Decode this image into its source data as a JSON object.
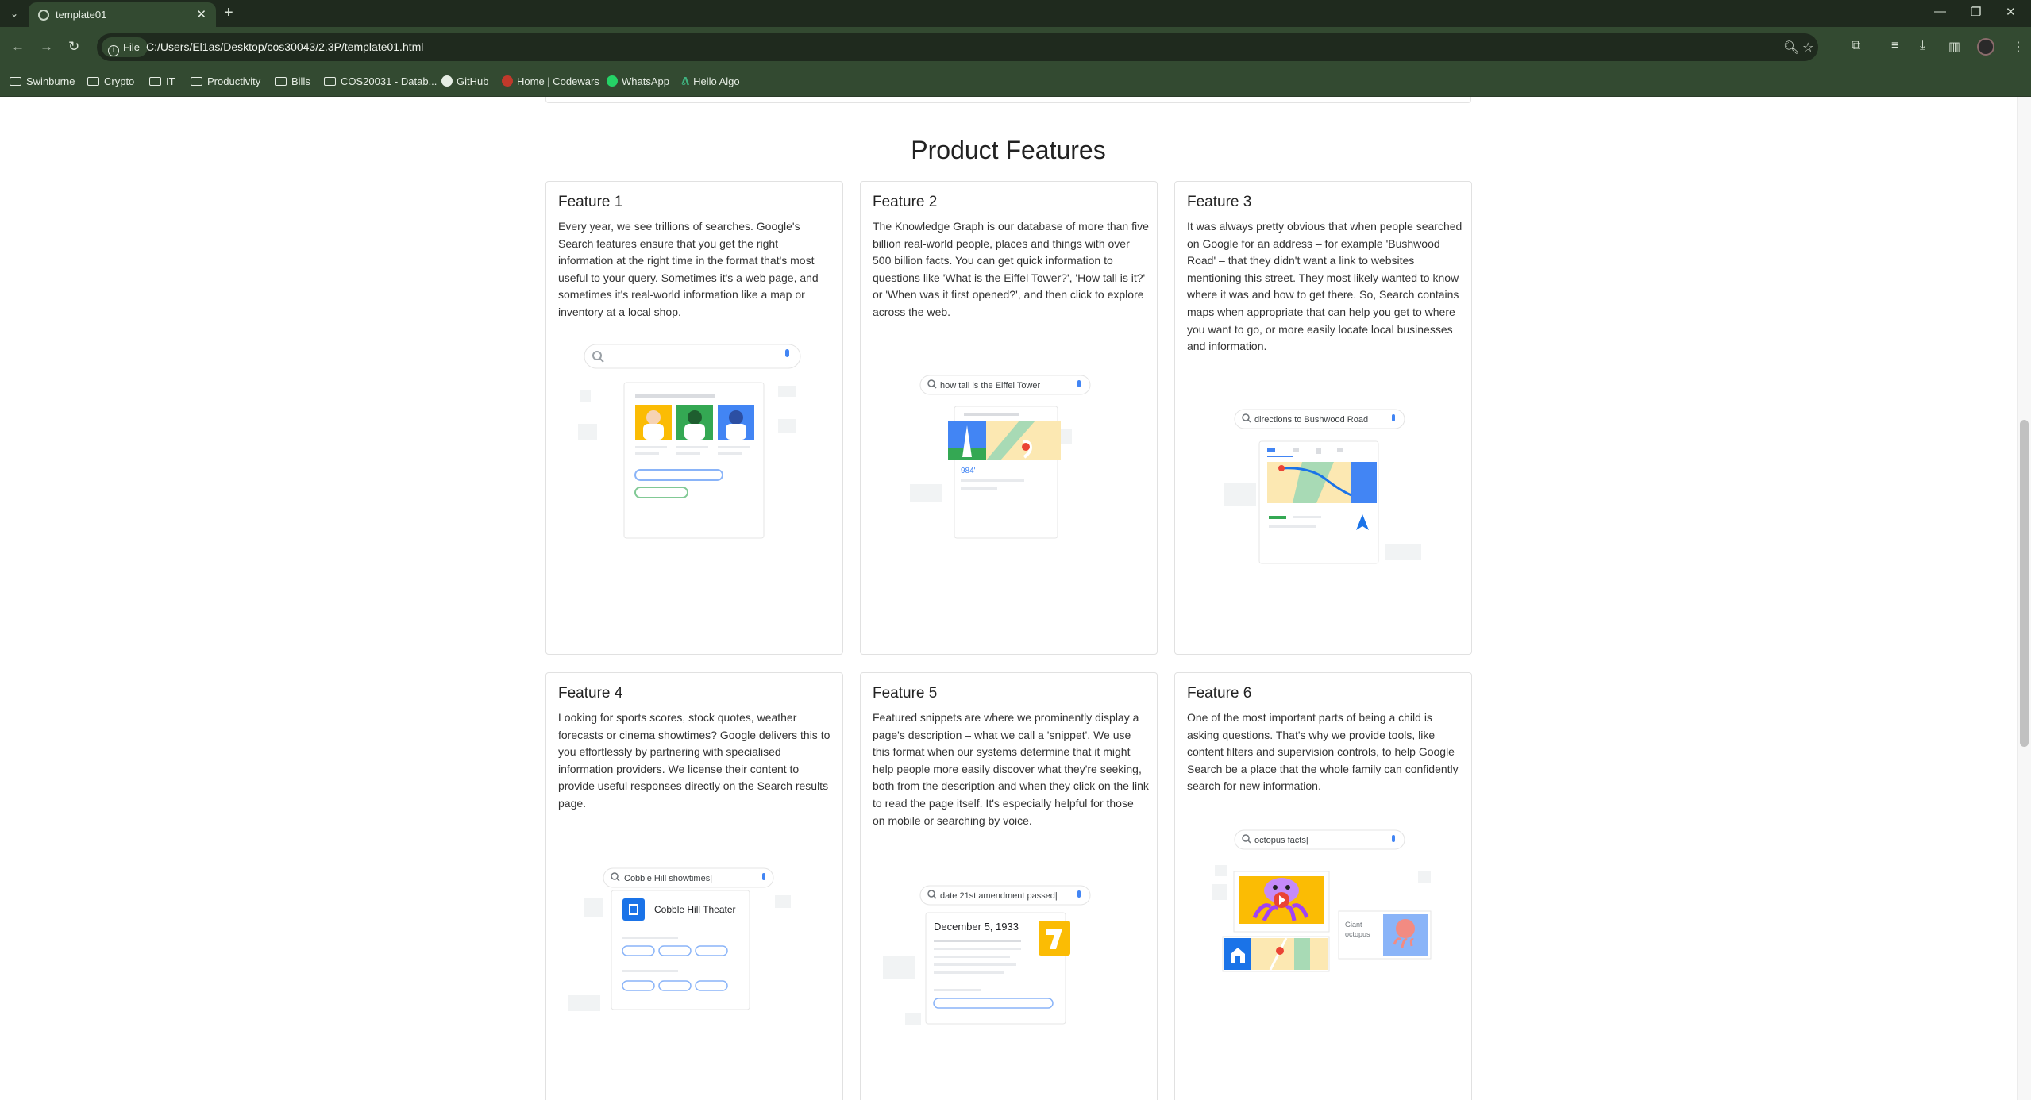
{
  "browser": {
    "tab_title": "template01",
    "url_scheme": "File",
    "url": "C:/Users/El1as/Desktop/cos30043/2.3P/template01.html",
    "bookmarks": [
      "Swinburne",
      "Crypto",
      "IT",
      "Productivity",
      "Bills",
      "COS20031 - Datab...",
      "GitHub",
      "Home | Codewars",
      "WhatsApp",
      "Hello Algo"
    ]
  },
  "page": {
    "section_title": "Product Features",
    "features": [
      {
        "title": "Feature 1",
        "text": "Every year, we see trillions of searches. Google's Search features ensure that you get the right information at the right time in the format that's most useful to your query. Sometimes it's a web page, and sometimes it's real-world information like a map or inventory at a local shop."
      },
      {
        "title": "Feature 2",
        "text": "The Knowledge Graph is our database of more than five billion real-world people, places and things with over 500 billion facts. You can get quick information to questions like 'What is the Eiffel Tower?', 'How tall is it?' or 'When was it first opened?', and then click to explore across the web.",
        "search_query": "how tall is the Eiffel Tower",
        "answer": "984'"
      },
      {
        "title": "Feature 3",
        "text": "It was always pretty obvious that when people searched on Google for an address – for example 'Bushwood Road' – that they didn't want a link to websites mentioning this street. They most likely wanted to know where it was and how to get there. So, Search contains maps when appropriate that can help you get to where you want to go, or more easily locate local businesses and information.",
        "search_query": "directions to Bushwood Road"
      },
      {
        "title": "Feature 4",
        "text": "Looking for sports scores, stock quotes, weather forecasts or cinema showtimes? Google delivers this to you effortlessly by partnering with specialised information providers. We license their content to provide useful responses directly on the Search results page.",
        "search_query": "Cobble Hill showtimes|",
        "result_title": "Cobble Hill Theater"
      },
      {
        "title": "Feature 5",
        "text": "Featured snippets are where we prominently display a page's description – what we call a 'snippet'. We use this format when our systems determine that it might help people more easily discover what they're seeking, both from the description and when they click on the link to read the page itself. It's especially helpful for those on mobile or searching by voice.",
        "search_query": "date 21st amendment passed|",
        "answer": "December 5, 1933"
      },
      {
        "title": "Feature 6",
        "text": "One of the most important parts of being a child is asking questions. That's why we provide tools, like content filters and supervision controls, to help Google Search be a place that the whole family can confidently search for new information.",
        "search_query": "octopus facts|",
        "caption": "Giant octopus"
      }
    ]
  },
  "colors": {
    "chrome_dark": "#1f2a1e",
    "chrome": "#334a31",
    "google_blue": "#4285f4",
    "google_green": "#34a853",
    "google_yellow": "#fbbc04",
    "google_red": "#ea4335"
  }
}
